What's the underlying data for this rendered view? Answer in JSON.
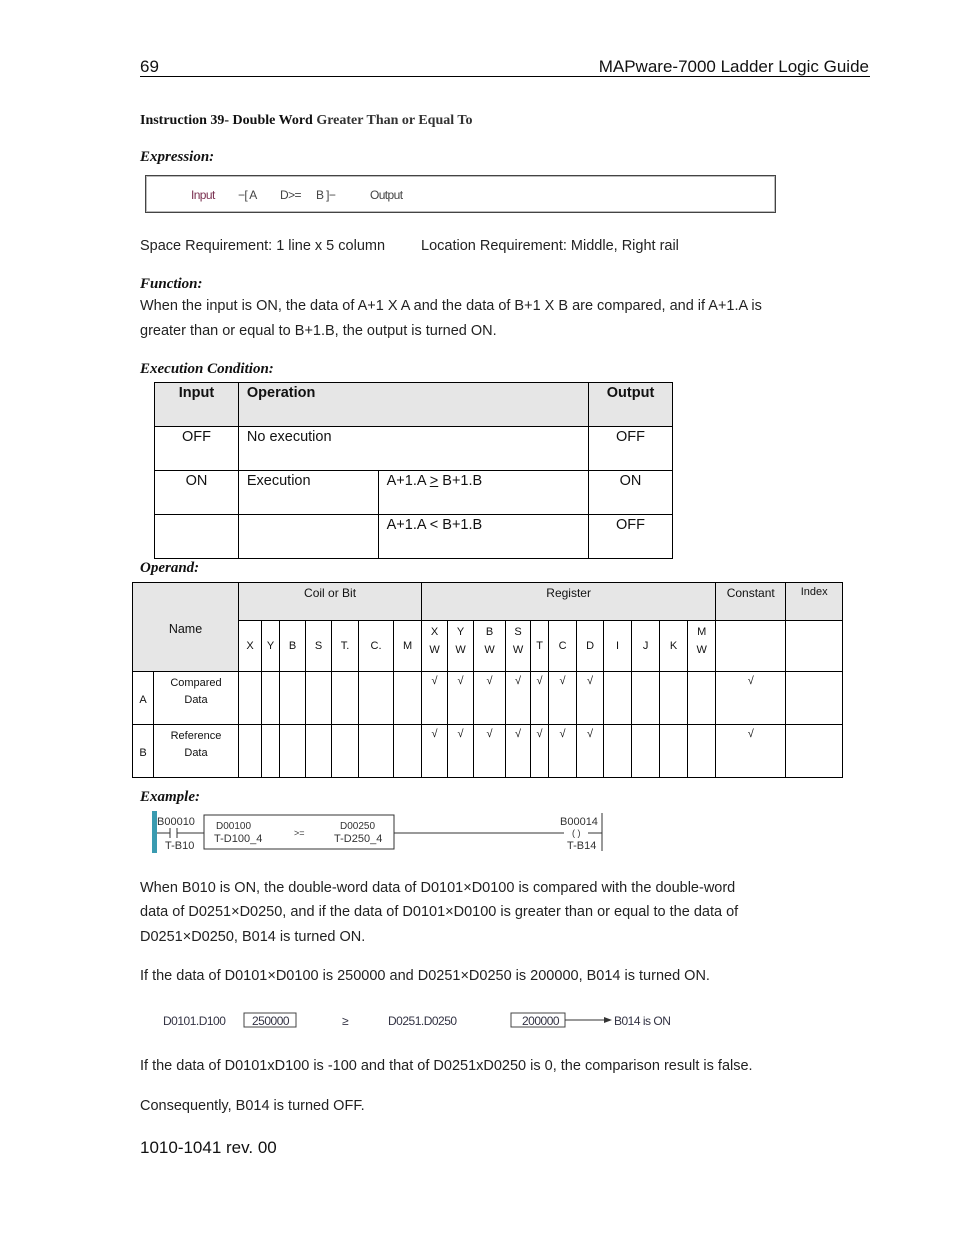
{
  "header": {
    "page_number": "69",
    "guide_title": "MAPware-7000 Ladder Logic Guide"
  },
  "instruction": {
    "title_bold": "Instruction 39- Double Word",
    "title_rest": "Greater Than or Equal To"
  },
  "expression": {
    "heading": "Expression:",
    "input_label": "Input",
    "open_bracket": "−[ A",
    "operator": "D>=",
    "close_bracket": "B ]−",
    "output_label": "Output"
  },
  "requirements": {
    "space": "Space Requirement: 1 line x 5 column",
    "location": "Location Requirement: Middle, Right rail"
  },
  "function": {
    "heading": "Function:",
    "line1": "When the input is ON, the data of A+1 X A and the data of B+1 X B are compared, and if A+1.A is",
    "line2": "greater than or equal to B+1.B, the output is turned ON."
  },
  "execution_condition": {
    "heading": "Execution Condition:",
    "headers": {
      "input": "Input",
      "operation": "Operation",
      "output": "Output"
    },
    "rows": [
      {
        "input": "OFF",
        "operation": "No execution",
        "condition": "",
        "output": "OFF"
      },
      {
        "input": "ON",
        "operation": "Execution",
        "condition_prefix": "A+1.A ",
        "condition_op": ">",
        "condition_suffix": " B+1.B",
        "output": "ON"
      },
      {
        "input": "",
        "operation": "",
        "condition": "A+1.A < B+1.B",
        "output": "OFF"
      }
    ]
  },
  "operand": {
    "heading": "Operand:",
    "groups": {
      "coil_or_bit": "Coil or Bit",
      "register": "Register",
      "constant": "Constant",
      "index": "Index"
    },
    "name_header": "Name",
    "coil_columns": [
      "X",
      "Y",
      "B",
      "S",
      "T.",
      "C.",
      "M"
    ],
    "register_columns": [
      [
        "X",
        "W"
      ],
      [
        "Y",
        "W"
      ],
      [
        "B",
        "W"
      ],
      [
        "S",
        "W"
      ],
      [
        "T",
        ""
      ],
      [
        "C",
        ""
      ],
      [
        "D",
        ""
      ],
      [
        "I",
        ""
      ],
      [
        "J",
        ""
      ],
      [
        "K",
        ""
      ],
      [
        "M",
        "W"
      ]
    ],
    "rows": [
      {
        "key": "A",
        "name_line1": "Compared",
        "name_line2": "Data",
        "register_marks": [
          "√",
          "√",
          "√",
          "√",
          "√",
          "√",
          "√",
          "",
          "",
          "",
          ""
        ],
        "constant": "√",
        "index": ""
      },
      {
        "key": "B",
        "name_line1": "Reference",
        "name_line2": "Data",
        "register_marks": [
          "√",
          "√",
          "√",
          "√",
          "√",
          "√",
          "√",
          "",
          "",
          "",
          ""
        ],
        "constant": "√",
        "index": ""
      }
    ]
  },
  "example": {
    "heading": "Example:",
    "ladder": {
      "input_address": "B00010",
      "input_tag": "T-B10",
      "operand_a_address": "D00100",
      "operand_a_tag": "T-D100_4",
      "operator": ">=",
      "operand_b_address": "D00250",
      "operand_b_tag": "T-D250_4",
      "output_address": "B00014",
      "output_tag": "T-B14",
      "rail_color": "#3a9bb0"
    },
    "para1_line1": "When B010 is ON, the double-word data of D0101×D0100 is compared with the double-word",
    "para1_line2": "data of D0251×D0250, and if the data of D0101×D0100 is greater than or equal to the data of",
    "para1_line3": "D0251×D0250, B014 is turned ON.",
    "para2": "If the data of D0101×D0100 is 250000 and D0251×D0250 is 200000, B014 is turned ON.",
    "comparison": {
      "left_label": "D0101.D100",
      "left_value": "250000",
      "operator": "≥",
      "right_label": "D0251.D0250",
      "right_value": "200000",
      "result": "B014 is ON"
    },
    "para3": "If the data of D0101xD100 is -100 and that of D0251xD0250 is 0, the comparison result is false.",
    "para4": "Consequently, B014 is turned OFF."
  },
  "footer": {
    "doc_number": "1010-1041 rev. 00"
  }
}
